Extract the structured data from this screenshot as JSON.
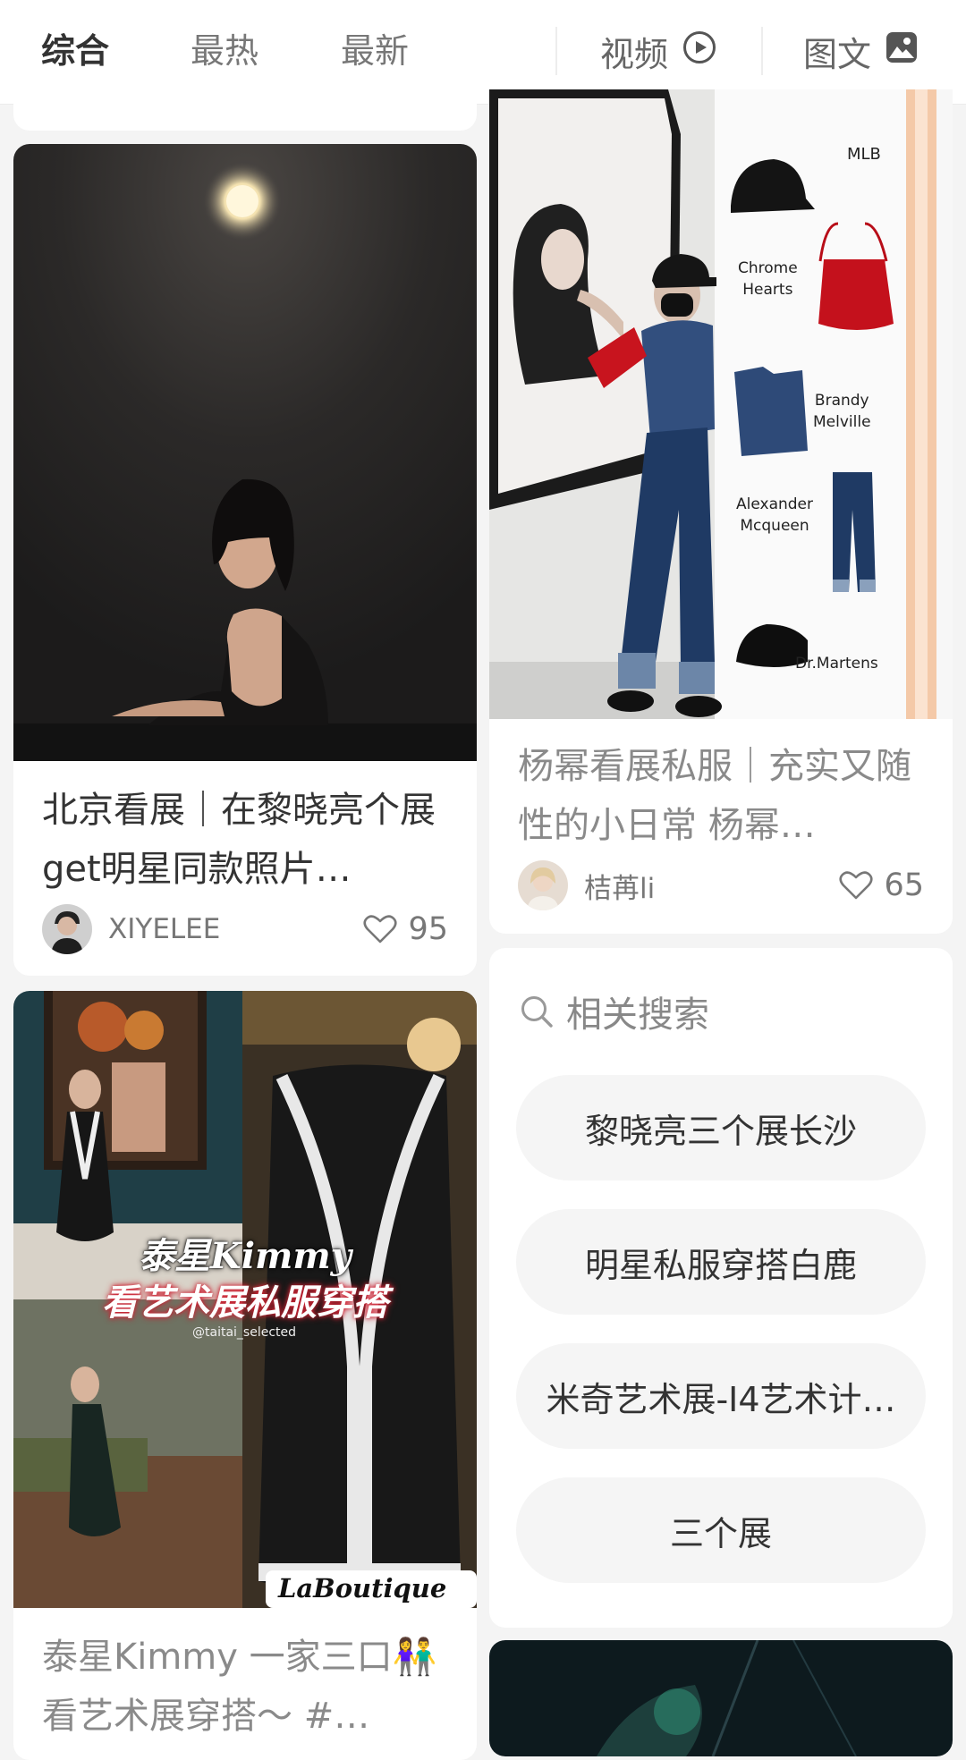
{
  "filters": {
    "tabs": [
      {
        "label": "综合",
        "active": true
      },
      {
        "label": "最热",
        "active": false
      },
      {
        "label": "最新",
        "active": false
      }
    ],
    "video_label": "视频",
    "graphic_label": "图文"
  },
  "feed": {
    "card_exhibition": {
      "title": "北京看展｜在黎晓亮个展get明星同款照片…",
      "author": "XIYELEE",
      "likes": "95"
    },
    "card_yangmi": {
      "title": "杨幂看展私服｜充实又随性的小日常 杨幂…",
      "author": "桔苒li",
      "likes": "65",
      "image_labels": {
        "mlb": "MLB",
        "chrome": "Chrome\nHearts",
        "brandy": "Brandy\nMelville",
        "mcqueen": "Alexander\nMcqueen",
        "martens": "Dr.Martens"
      }
    },
    "card_kimmy": {
      "image_title_1": "泰星Kimmy",
      "image_title_2": "看艺术展私服穿搭",
      "image_handle": "@taitai_selected",
      "image_brand": "LaBoutique",
      "title": "泰星Kimmy 一家三口👫看艺术展穿搭～ #…"
    },
    "related_search": {
      "heading": "相关搜索",
      "items": [
        "黎晓亮三个展长沙",
        "明星私服穿搭白鹿",
        "米奇艺术展-I4艺术计…",
        "三个展"
      ]
    }
  },
  "colors": {
    "accent_text": "#333333",
    "muted_text": "#8a8a8a",
    "pill_bg": "#f5f5f5"
  }
}
